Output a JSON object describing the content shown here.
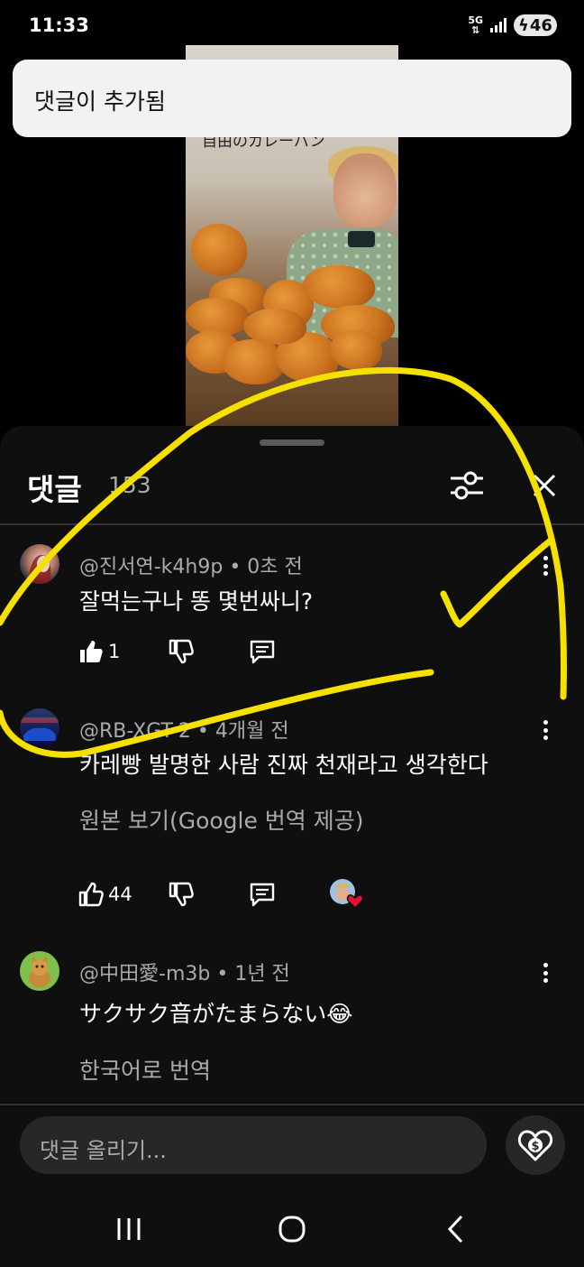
{
  "status_bar": {
    "time": "11:33",
    "network": "5G",
    "battery": "46"
  },
  "video": {
    "caption": "自由のカレーパン"
  },
  "toast": {
    "message": "댓글이 추가됨"
  },
  "comments_panel": {
    "title": "댓글",
    "count": "153",
    "comments": [
      {
        "author": "@진서연-k4h9p",
        "time": "0초 전",
        "text": "잘먹는구나 똥 몇번싸니?",
        "likes": "1"
      },
      {
        "author": "@RB-XGT-2",
        "time": "4개월 전",
        "text": "카레빵 발명한 사람 진짜 천재라고 생각한다",
        "translation_link": "원본 보기(Google 번역 제공)",
        "likes": "44",
        "creator_heart": true
      },
      {
        "author": "@中田愛-m3b",
        "time": "1년 전",
        "text": "サクサク音がたまらない😂",
        "translation_link": "한국어로 번역"
      }
    ],
    "composer_placeholder": "댓글 올리기..."
  },
  "colors": {
    "annotation": "#f5e000",
    "sheet_bg": "#0f0f0f"
  },
  "icons": [
    "filter-icon",
    "close-icon",
    "like-icon",
    "dislike-icon",
    "reply-icon",
    "more-icon",
    "thanks-icon",
    "nav-recents-icon",
    "nav-home-icon",
    "nav-back-icon"
  ]
}
